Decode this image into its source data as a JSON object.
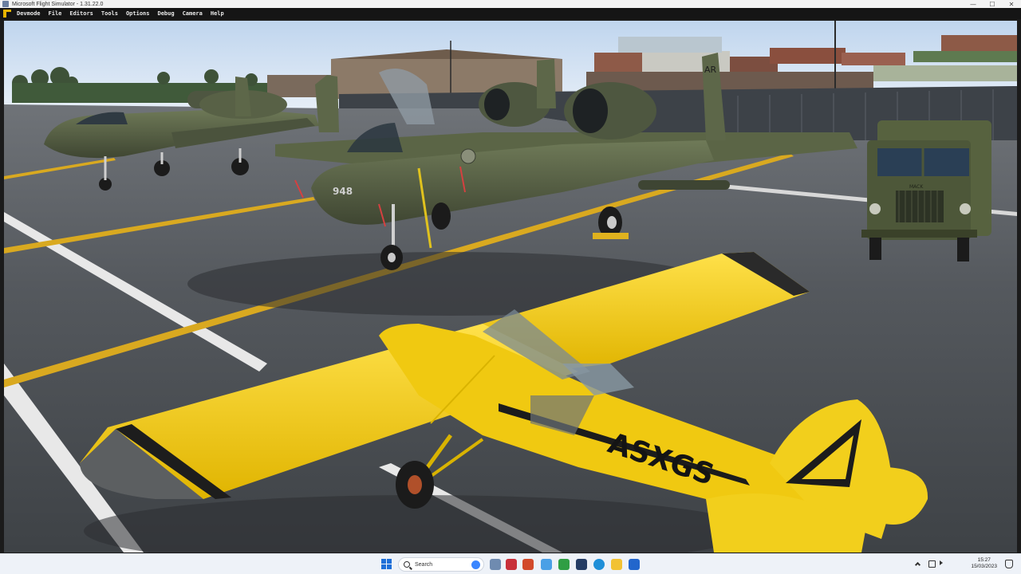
{
  "window": {
    "title": "Microsoft Flight Simulator - 1.31.22.0",
    "controls": {
      "minimize": "—",
      "maximize": "☐",
      "close": "✕"
    }
  },
  "menubar": {
    "items": [
      "Devmode",
      "File",
      "Editors",
      "Tools",
      "Options",
      "Debug",
      "Camera",
      "Help"
    ]
  },
  "scene": {
    "aircraft_registration": "ASXGS",
    "a10_tail_code": "AR",
    "a10_nose_number": "948",
    "truck_brand": "MACK",
    "colors": {
      "sky": "#c9dcf0",
      "tarmac": "#4a4d52",
      "yellow_plane": "#f2cf1c",
      "a10": "#5b6546",
      "truck": "#57623f",
      "taxiline": "#e6b51e"
    }
  },
  "taskbar": {
    "search_placeholder": "Search",
    "apps": [
      "task-view-icon",
      "photos-icon",
      "app-red-icon",
      "office-icon",
      "snip-icon",
      "xbox-icon",
      "msfs-icon",
      "edge-icon",
      "files-icon",
      "malwarebytes-icon"
    ],
    "clock_time": "15:27",
    "clock_date": "15/03/2023"
  }
}
